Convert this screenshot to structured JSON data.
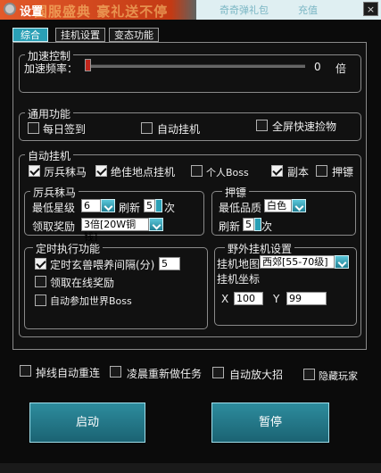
{
  "window": {
    "title": "设置",
    "bg_banner": "国服盛典 豪礼送不停",
    "top_links": [
      "奇奇弹礼包",
      "充值"
    ],
    "close_label": "×"
  },
  "tabs": [
    {
      "label": "综合"
    },
    {
      "label": "挂机设置"
    },
    {
      "label": "变态功能"
    }
  ],
  "accel": {
    "group_title": "加速控制",
    "freq_label": "加速频率：",
    "value": "0",
    "unit": "倍",
    "slider_level": 0
  },
  "general": {
    "group_title": "通用功能",
    "items": [
      {
        "label": "每日签到",
        "checked": false
      },
      {
        "label": "自动挂机",
        "checked": false
      },
      {
        "label": "全屏快速捡物",
        "checked": false
      }
    ]
  },
  "auto": {
    "group_title": "自动挂机",
    "options": [
      {
        "label": "厉兵秣马",
        "checked": true
      },
      {
        "label": "绝佳地点挂机",
        "checked": true
      },
      {
        "label": "个人Boss",
        "checked": false
      },
      {
        "label": "副本",
        "checked": true
      },
      {
        "label": "押镖",
        "checked": false
      }
    ]
  },
  "libing": {
    "group_title": "厉兵秣马",
    "min_star_label": "最低星级",
    "min_star_value": "6",
    "refresh_label": "刷新",
    "refresh_value": "5",
    "times_unit": "次",
    "claim_label": "领取奖励",
    "claim_value": "3倍[20W铜钱]"
  },
  "yabiao": {
    "group_title": "押镖",
    "min_quality_label": "最低品质",
    "min_quality_value": "白色",
    "refresh_label": "刷新",
    "refresh_value": "5",
    "times_unit": "次"
  },
  "timed": {
    "group_title": "定时执行功能",
    "items": [
      {
        "label": "定时玄兽喂养间隔(分)",
        "checked": true,
        "value": "5"
      },
      {
        "label": "领取在线奖励",
        "checked": false
      },
      {
        "label": "自动参加世界Boss",
        "checked": false
      }
    ]
  },
  "field": {
    "group_title": "野外挂机设置",
    "map_label": "挂机地图",
    "map_value": "西郊[55-70级]",
    "coord_label": "挂机坐标",
    "x_label": "X",
    "x_value": "100",
    "y_label": "Y",
    "y_value": "99"
  },
  "bottom_options": [
    {
      "label": "掉线自动重连",
      "checked": false
    },
    {
      "label": "凌晨重新做任务",
      "checked": false
    },
    {
      "label": "自动放大招",
      "checked": false
    },
    {
      "label": "隐藏玩家",
      "checked": false
    }
  ],
  "buttons": {
    "start": "启动",
    "pause": "暂停"
  }
}
